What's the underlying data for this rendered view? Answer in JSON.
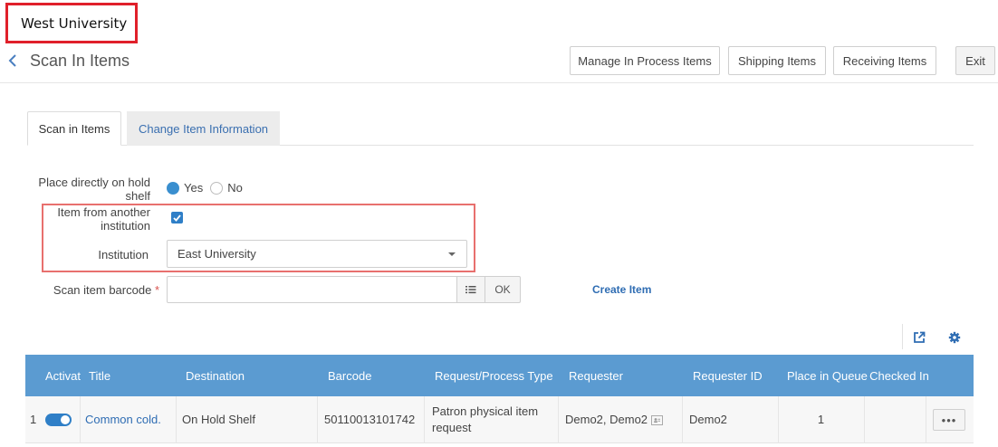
{
  "institution_label": "West University",
  "header": {
    "title": "Scan In Items",
    "buttons": {
      "manage": "Manage In Process Items",
      "shipping": "Shipping Items",
      "receiving": "Receiving Items",
      "exit": "Exit"
    }
  },
  "tabs": [
    {
      "label": "Scan in Items",
      "active": true
    },
    {
      "label": "Change Item Information",
      "active": false
    }
  ],
  "form": {
    "hold_shelf_label": "Place directly on hold shelf",
    "hold_shelf_options": [
      "Yes",
      "No"
    ],
    "hold_shelf_value": "Yes",
    "other_institution_label": "Item from another institution",
    "other_institution_checked": true,
    "institution_field_label": "Institution",
    "institution_value": "East University",
    "barcode_label": "Scan item barcode",
    "barcode_required_mark": "*",
    "barcode_value": "",
    "ok_label": "OK",
    "create_item_label": "Create Item"
  },
  "table": {
    "columns": [
      "Activat",
      "Title",
      "Destination",
      "Barcode",
      "Request/Process Type",
      "Requester",
      "Requester ID",
      "Place in Queue",
      "Checked In"
    ],
    "rows": [
      {
        "index": "1",
        "active": true,
        "title": "Common cold.",
        "destination": "On Hold Shelf",
        "barcode": "50110013101742",
        "request_type": "Patron physical item request",
        "requester": "Demo2, Demo2",
        "requester_id": "Demo2",
        "place_in_queue": "1",
        "checked_in": "",
        "actions_label": "•••"
      }
    ]
  },
  "colors": {
    "accent": "#3a8fcf",
    "table_header": "#5b9bd1",
    "link": "#2f6db3",
    "highlight_border": "#e8706e",
    "institution_border": "#e0202a"
  }
}
